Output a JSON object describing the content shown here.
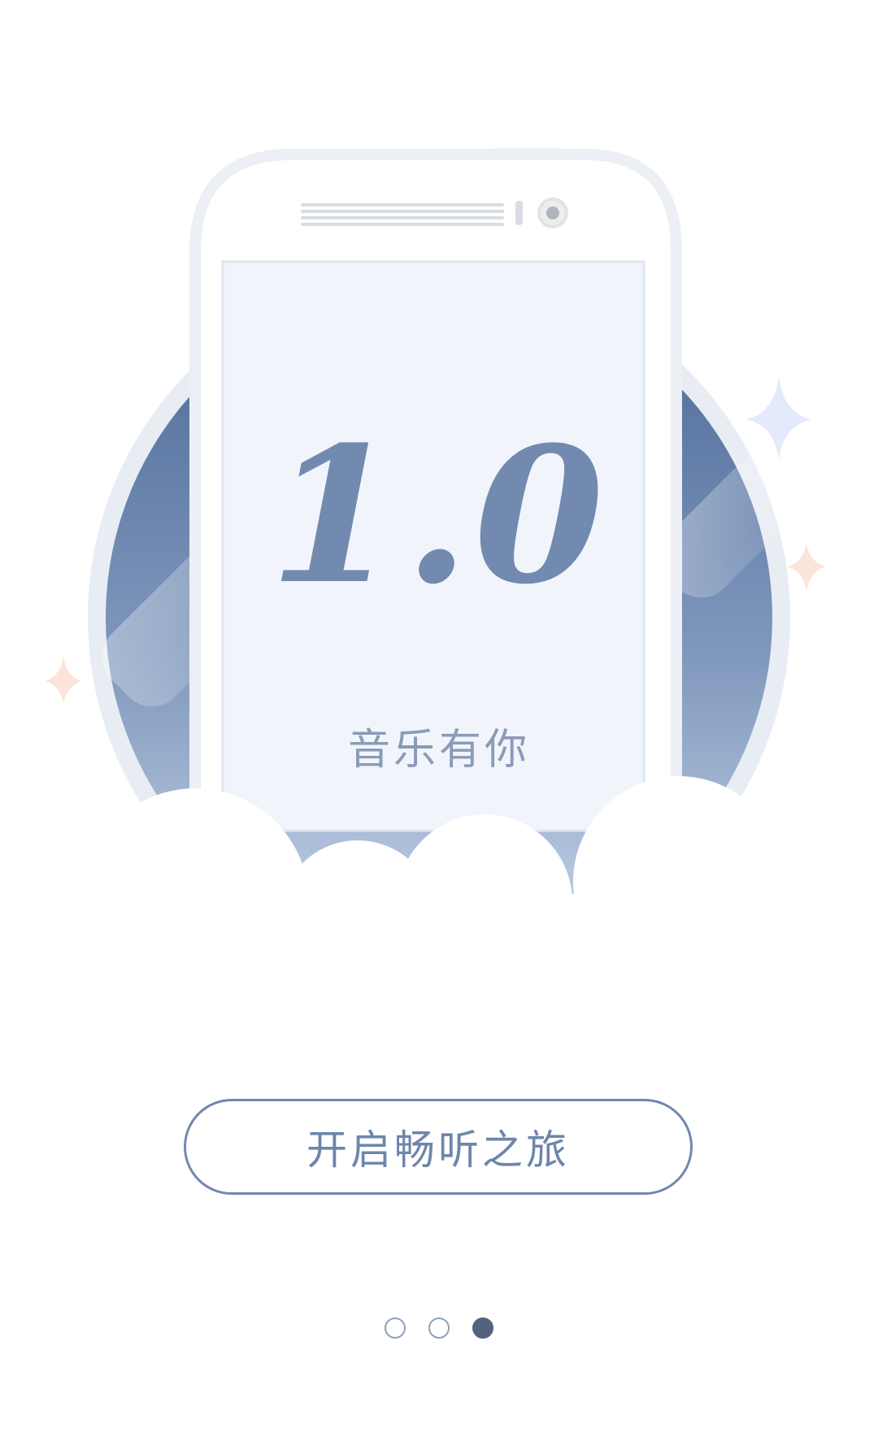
{
  "hero": {
    "version": "1.0",
    "tagline": "音乐有你"
  },
  "start_button": {
    "label": "开启畅听之旅"
  },
  "pager": {
    "pages": 3,
    "active_index": 2
  },
  "colors": {
    "accent": "#7088ad",
    "circle_dark": "#51709f",
    "circle_light": "#c7d5e8",
    "screen_bg": "#f1f5fb",
    "dot_active": "#53627f",
    "sparkle_blue": "#e3ebfb",
    "sparkle_peach": "#fbe9e0"
  }
}
